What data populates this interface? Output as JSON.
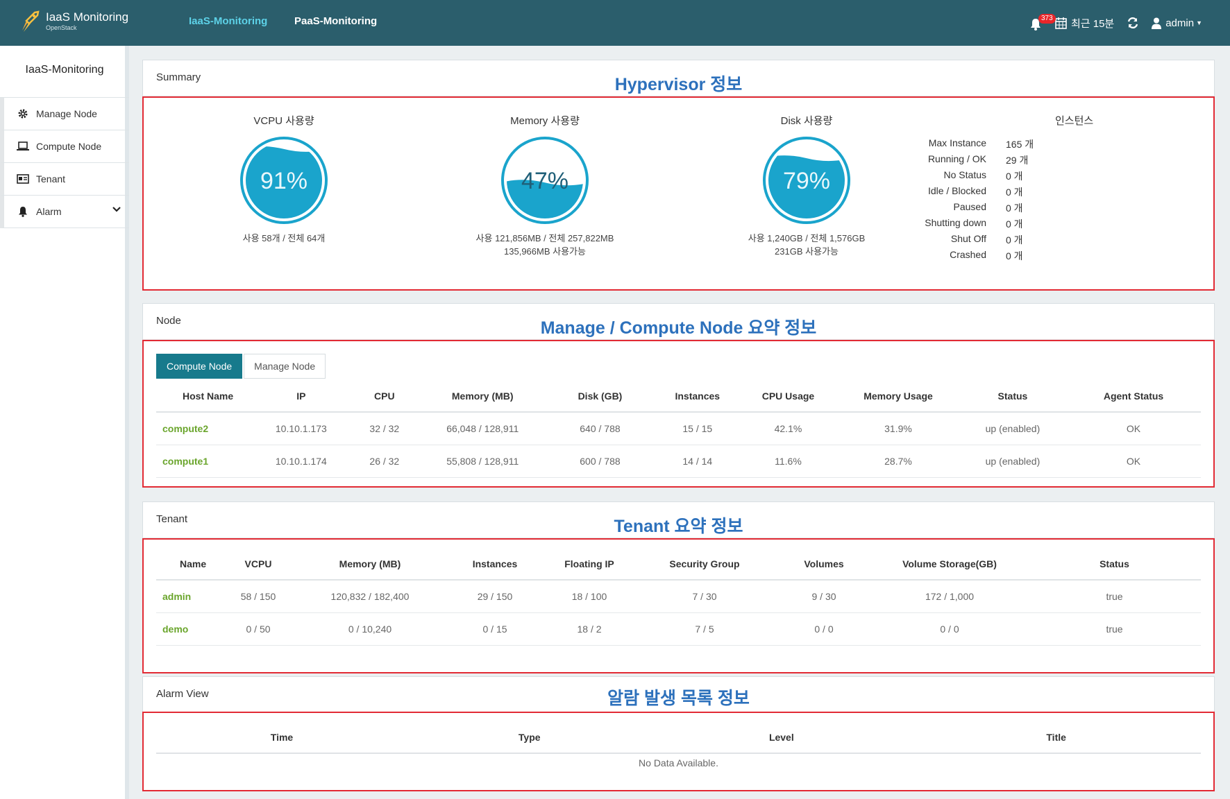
{
  "brand": {
    "title": "IaaS Monitoring",
    "subtitle": "OpenStack"
  },
  "topnav": [
    {
      "label": "IaaS-Monitoring",
      "active": true
    },
    {
      "label": "PaaS-Monitoring",
      "active": false
    }
  ],
  "topright": {
    "alarm_count": "373",
    "time_range": "최근 15분",
    "user": "admin"
  },
  "colors": {
    "topbar": "#2b5e6c",
    "accent": "#177a8c",
    "gauge": "#1aa4cc",
    "link_green": "#6aa52c",
    "annotation": "#2d71bc",
    "highlight_box": "#e22a34"
  },
  "sidebar": {
    "title": "IaaS-Monitoring",
    "items": [
      {
        "label": "Manage Node",
        "icon": "gear-icon"
      },
      {
        "label": "Compute Node",
        "icon": "laptop-icon"
      },
      {
        "label": "Tenant",
        "icon": "id-card-icon"
      },
      {
        "label": "Alarm",
        "icon": "bell-icon"
      }
    ]
  },
  "summary": {
    "title": "Summary",
    "annotation": "Hypervisor 정보",
    "gauges": [
      {
        "label": "VCPU 사용량",
        "percent": 91,
        "value_text": "91%",
        "sub1": "사용 58개 / 전체 64개",
        "sub2": ""
      },
      {
        "label": "Memory 사용량",
        "percent": 47,
        "value_text": "47%",
        "sub1": "사용 121,856MB / 전체 257,822MB",
        "sub2": "135,966MB 사용가능"
      },
      {
        "label": "Disk 사용량",
        "percent": 79,
        "value_text": "79%",
        "sub1": "사용 1,240GB / 전체 1,576GB",
        "sub2": "231GB 사용가능"
      }
    ],
    "instances": {
      "title": "인스턴스",
      "rows": [
        {
          "k": "Max Instance",
          "v": "165 개"
        },
        {
          "k": "Running / OK",
          "v": "29 개"
        },
        {
          "k": "No Status",
          "v": "0 개"
        },
        {
          "k": "Idle / Blocked",
          "v": "0 개"
        },
        {
          "k": "Paused",
          "v": "0 개"
        },
        {
          "k": "Shutting down",
          "v": "0 개"
        },
        {
          "k": "Shut Off",
          "v": "0 개"
        },
        {
          "k": "Crashed",
          "v": "0 개"
        }
      ]
    }
  },
  "node": {
    "title": "Node",
    "annotation": "Manage / Compute Node 요약 정보",
    "tabs": [
      "Compute Node",
      "Manage Node"
    ],
    "columns": [
      "Host Name",
      "IP",
      "CPU",
      "Memory (MB)",
      "Disk (GB)",
      "Instances",
      "CPU Usage",
      "Memory Usage",
      "Status",
      "Agent Status"
    ],
    "rows": [
      [
        "compute2",
        "10.10.1.173",
        "32 / 32",
        "66,048 / 128,911",
        "640 / 788",
        "15 / 15",
        "42.1%",
        "31.9%",
        "up (enabled)",
        "OK"
      ],
      [
        "compute1",
        "10.10.1.174",
        "26 / 32",
        "55,808 / 128,911",
        "600 / 788",
        "14 / 14",
        "11.6%",
        "28.7%",
        "up (enabled)",
        "OK"
      ]
    ]
  },
  "tenant": {
    "title": "Tenant",
    "annotation": "Tenant 요약 정보",
    "columns": [
      "Name",
      "VCPU",
      "Memory (MB)",
      "Instances",
      "Floating IP",
      "Security Group",
      "Volumes",
      "Volume Storage(GB)",
      "Status"
    ],
    "rows": [
      [
        "admin",
        "58 / 150",
        "120,832 / 182,400",
        "29 / 150",
        "18 / 100",
        "7 / 30",
        "9 / 30",
        "172 / 1,000",
        "true"
      ],
      [
        "demo",
        "0 / 50",
        "0 / 10,240",
        "0 / 15",
        "18 / 2",
        "7 / 5",
        "0 / 0",
        "0 / 0",
        "true"
      ]
    ]
  },
  "alarm": {
    "title": "Alarm View",
    "annotation": "알람 발생 목록 정보",
    "columns": [
      "Time",
      "Type",
      "Level",
      "Title"
    ],
    "empty": "No Data Available."
  }
}
